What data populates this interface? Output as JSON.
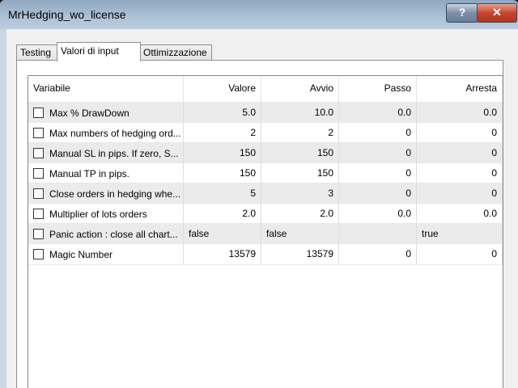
{
  "window": {
    "title": "MrHedging_wo_license",
    "help_label": "?",
    "close_label": "✕"
  },
  "tabs": [
    {
      "label": "Testing"
    },
    {
      "label": "Valori di input"
    },
    {
      "label": "Ottimizzazione"
    }
  ],
  "columns": [
    "Variabile",
    "Valore",
    "Avvio",
    "Passo",
    "Arresta"
  ],
  "rows": [
    {
      "name": "Max % DrawDown",
      "valore": "5.0",
      "avvio": "10.0",
      "passo": "0.0",
      "arresta": "0.0"
    },
    {
      "name": "Max numbers of hedging ord...",
      "valore": "2",
      "avvio": "2",
      "passo": "0",
      "arresta": "0"
    },
    {
      "name": "Manual SL in pips. If zero, S...",
      "valore": "150",
      "avvio": "150",
      "passo": "0",
      "arresta": "0"
    },
    {
      "name": "Manual TP in pips.",
      "valore": "150",
      "avvio": "150",
      "passo": "0",
      "arresta": "0"
    },
    {
      "name": "Close orders in hedging whe...",
      "valore": "5",
      "avvio": "3",
      "passo": "0",
      "arresta": "0"
    },
    {
      "name": "Multiplier of lots orders",
      "valore": "2.0",
      "avvio": "2.0",
      "passo": "0.0",
      "arresta": "0.0"
    },
    {
      "name": "Panic action : close all chart...",
      "valore": "false",
      "avvio": "false",
      "passo": "",
      "arresta": "true"
    },
    {
      "name": "Magic Number",
      "valore": "13579",
      "avvio": "13579",
      "passo": "0",
      "arresta": "0"
    }
  ],
  "colors": {
    "title_gradient": "#aec2d6",
    "close_button": "#c7462f",
    "alt_row": "#ebebeb"
  }
}
